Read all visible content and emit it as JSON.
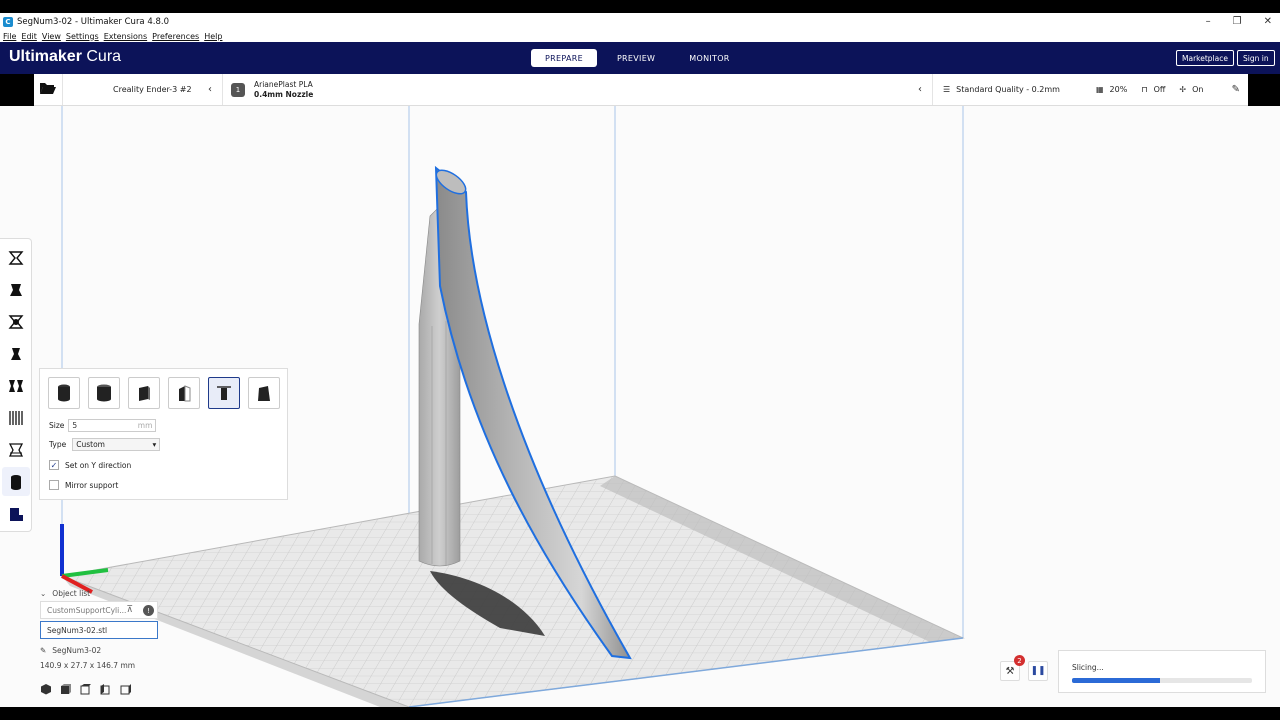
{
  "window": {
    "title": "SegNum3-02 - Ultimaker Cura 4.8.0",
    "app_icon_letter": "C",
    "controls": [
      "–",
      "❐",
      "✕"
    ]
  },
  "menu": [
    "File",
    "Edit",
    "View",
    "Settings",
    "Extensions",
    "Preferences",
    "Help"
  ],
  "header": {
    "brand_bold": "Ultimaker",
    "brand_light": " Cura",
    "stages": [
      "PREPARE",
      "PREVIEW",
      "MONITOR"
    ],
    "active_stage": "PREPARE",
    "marketplace_label": "Marketplace",
    "signin_label": "Sign in"
  },
  "stagebar": {
    "printer": "Creality Ender-3 #2",
    "material_name": "ArianePlast PLA",
    "nozzle": "0.4mm Nozzle",
    "extruder_number": "1",
    "quality": "Standard Quality - 0.2mm",
    "infill": "20%",
    "support": "Off",
    "adhesion": "On"
  },
  "support_tool": {
    "size_label": "Size",
    "size_value": "5",
    "size_unit": "mm",
    "type_label": "Type",
    "type_value": "Custom",
    "y_direction_label": "Set on Y direction",
    "y_direction_checked": true,
    "mirror_label": "Mirror support",
    "mirror_checked": false,
    "active_shape_index": 4
  },
  "objects": {
    "header": "Object list",
    "items": [
      {
        "name": "CustomSupportCyli...",
        "selected": false
      },
      {
        "name": "SegNum3-02.stl",
        "selected": true
      }
    ],
    "current_name": "SegNum3-02",
    "dimensions": "140.9 x 27.7 x 146.7 mm"
  },
  "slicing": {
    "label": "Slicing...",
    "progress": 0.49,
    "badge_count": "2"
  },
  "colors": {
    "header_bg": "#0c1359",
    "accent": "#2b6ad6",
    "selection_outline": "#1f6fe0"
  }
}
